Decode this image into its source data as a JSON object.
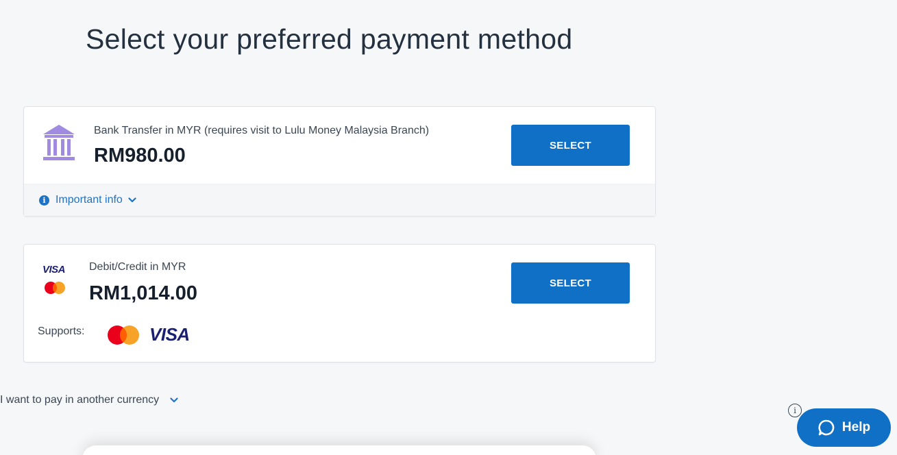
{
  "page": {
    "title": "Select your preferred payment method"
  },
  "methods": [
    {
      "label": "Bank Transfer in MYR (requires visit to Lulu Money Malaysia Branch)",
      "amount": "RM980.00",
      "select_label": "SELECT",
      "info_label": "Important info",
      "icon": "bank-icon"
    },
    {
      "label": "Debit/Credit in MYR",
      "amount": "RM1,014.00",
      "select_label": "SELECT",
      "supports_label": "Supports:",
      "brand_visa": "VISA",
      "icon": "visa-mastercard-icon"
    }
  ],
  "another_currency": {
    "label": "I want to pay in another currency"
  },
  "help": {
    "label": "Help",
    "info_glyph": "i"
  },
  "colors": {
    "primary": "#1070c6",
    "bank_icon": "#a18be0",
    "visa_blue": "#1a1f71",
    "mc_red": "#eb001b",
    "mc_orange": "#f79e1b",
    "background": "#f6f7f8"
  }
}
